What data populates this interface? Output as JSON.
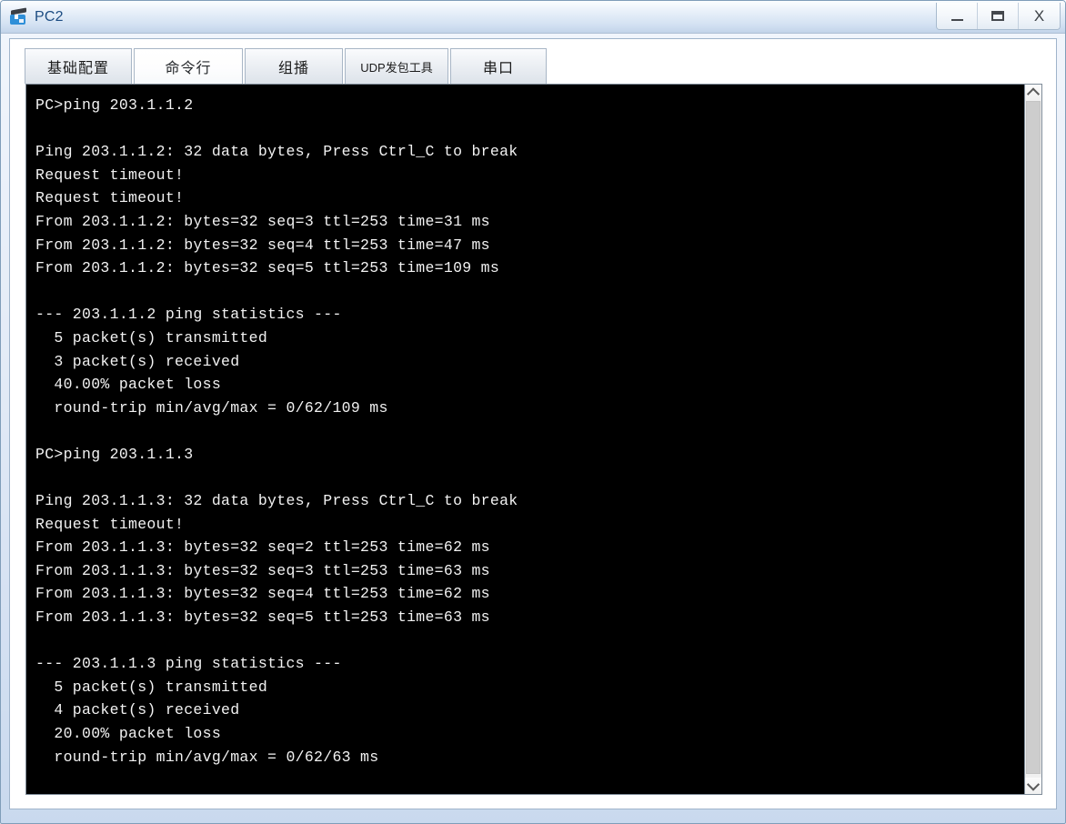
{
  "window": {
    "title": "PC2",
    "icon": "pc-device-icon",
    "controls": {
      "minimize": "_",
      "maximize": "❐",
      "close": "X"
    }
  },
  "tabs": [
    {
      "label": "基础配置",
      "active": false,
      "small": false
    },
    {
      "label": "命令行",
      "active": true,
      "small": false
    },
    {
      "label": "组播",
      "active": false,
      "small": false
    },
    {
      "label": "UDP发包工具",
      "active": false,
      "small": true
    },
    {
      "label": "串口",
      "active": false,
      "small": false
    }
  ],
  "terminal": {
    "background": "#000000",
    "foreground": "#f2f2f2",
    "lines": [
      "PC>ping 203.1.1.2",
      "",
      "Ping 203.1.1.2: 32 data bytes, Press Ctrl_C to break",
      "Request timeout!",
      "Request timeout!",
      "From 203.1.1.2: bytes=32 seq=3 ttl=253 time=31 ms",
      "From 203.1.1.2: bytes=32 seq=4 ttl=253 time=47 ms",
      "From 203.1.1.2: bytes=32 seq=5 ttl=253 time=109 ms",
      "",
      "--- 203.1.1.2 ping statistics ---",
      "  5 packet(s) transmitted",
      "  3 packet(s) received",
      "  40.00% packet loss",
      "  round-trip min/avg/max = 0/62/109 ms",
      "",
      "PC>ping 203.1.1.3",
      "",
      "Ping 203.1.1.3: 32 data bytes, Press Ctrl_C to break",
      "Request timeout!",
      "From 203.1.1.3: bytes=32 seq=2 ttl=253 time=62 ms",
      "From 203.1.1.3: bytes=32 seq=3 ttl=253 time=63 ms",
      "From 203.1.1.3: bytes=32 seq=4 ttl=253 time=62 ms",
      "From 203.1.1.3: bytes=32 seq=5 ttl=253 time=63 ms",
      "",
      "--- 203.1.1.3 ping statistics ---",
      "  5 packet(s) transmitted",
      "  4 packet(s) received",
      "  20.00% packet loss",
      "  round-trip min/avg/max = 0/62/63 ms"
    ]
  },
  "scrollbar": {
    "up_arrow": "scroll-up-icon",
    "down_arrow": "scroll-down-icon"
  }
}
